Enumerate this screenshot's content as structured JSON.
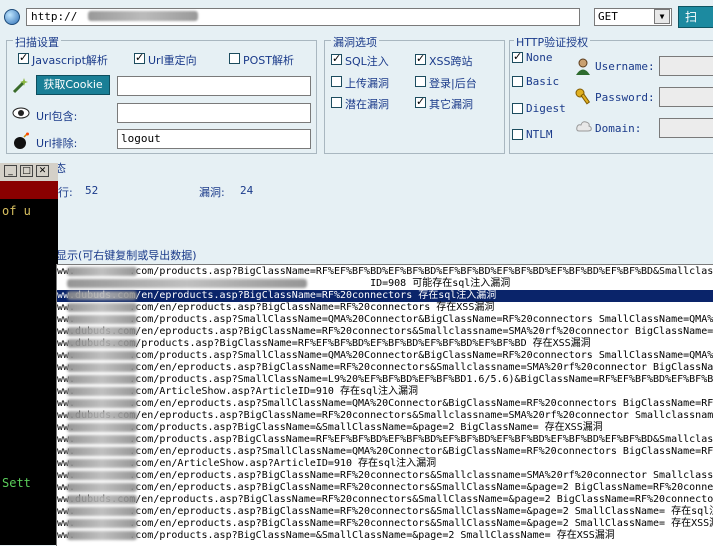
{
  "toolbar": {
    "url_value": "http://",
    "method_value": "GET",
    "scan_label": "扫"
  },
  "scan_settings": {
    "legend": "扫描设置",
    "js_parse": "Javascript解析",
    "url_redirect": "Url重定向",
    "post_parse": "POST解析",
    "get_cookie": "获取Cookie",
    "url_include": "Url包含:",
    "url_exclude": "Url排除:",
    "url_exclude_value": "logout"
  },
  "vuln_options": {
    "legend": "漏洞选项",
    "sql": "SQL注入",
    "xss": "XSS跨站",
    "upload": "上传漏洞",
    "login": "登录|后台",
    "latent": "潜在漏洞",
    "other": "其它漏洞"
  },
  "http_auth": {
    "legend": "HTTP验证授权",
    "none": "None",
    "basic": "Basic",
    "digest": "Digest",
    "ntlm": "NTLM",
    "username": "Username:",
    "password": "Password:",
    "domain": "Domain:"
  },
  "status": {
    "title_partial": "态",
    "rows_label": "行:",
    "rows_value": "52",
    "vulns_label": "漏洞:",
    "vulns_value": "24",
    "results_hint": "显示(可右键复制或导出数据)"
  },
  "mini_window": {
    "text1": "of u",
    "text2": "Sett"
  },
  "results": [
    {
      "text": "ww.         .com/products.asp?BigClassName=RF%EF%BF%BD%EF%BF%BD%EF%BF%BD%EF%BF%BD%EF%BF%BD%EF%BF%BD&Smallclassname"
    },
    {
      "text": "                                                    ID=908 可能存在sql注入漏洞"
    },
    {
      "text": "ww.dubuds.com/en/eproducts.asp?BigClassName=RF%20connectors 存在sql注入漏洞"
    },
    {
      "text": "ww.         .com/en/eproducts.asp?BigClassName=RF%20connectors 存在XSS漏洞"
    },
    {
      "text": "ww.         .com/products.asp?SmallClassName=QMA%20Connector&BigClassName=RF%20connectors SmallClassName=QMA%"
    },
    {
      "text": "ww.dubuds.com/en/eproducts.asp?BigClassName=RF%20connectors&Smallclassname=SMA%20rf%20connector BigClassName=R"
    },
    {
      "text": "ww.dubuds.com/products.asp?BigClassName=RF%EF%BF%BD%EF%BF%BD%EF%BF%BD%EF%BF%BD 存在XSS漏洞"
    },
    {
      "text": "ww.         .com/products.asp?SmallClassName=QMA%20Connector&BigClassName=RF%20connectors SmallClassName=QMA%"
    },
    {
      "text": "ww.         .com/en/eproducts.asp?BigClassName=RF%20connectors&Smallclassname=SMA%20rf%20connector BigClassName=R"
    },
    {
      "text": "ww.         .com/products.asp?SmallClassName=L9%20%EF%BF%BD%EF%BF%BD1.6/5.6)&BigClassName=RF%EF%BF%BD%EF%BF%BD%EF"
    },
    {
      "text": "ww.         .com/ArticleShow.asp?ArticleID=910 存在sql注入漏洞"
    },
    {
      "text": "ww.         .com/en/eproducts.asp?SmallClassName=QMA%20Connector&BigClassName=RF%20connectors BigClassName=RF%20co"
    },
    {
      "text": "ww.dubuds.com/en/eproducts.asp?BigClassName=RF%20connectors&Smallclassname=SMA%20rf%20connector Smallclassname"
    },
    {
      "text": "ww.         .com/products.asp?BigClassName=&SmallClassName=&page=2 BigClassName= 存在XSS漏洞"
    },
    {
      "text": "ww.         .com/products.asp?BigClassName=RF%EF%BF%BD%EF%BF%BD%EF%BF%BD%EF%BF%BD%EF%BF%BD%EF%BF%BD&Smallclassname"
    },
    {
      "text": "ww.         .com/en/eproducts.asp?SmallClassName=QMA%20Connector&BigClassName=RF%20connectors BigClassName=RF%20co"
    },
    {
      "text": "ww.         .com/en/ArticleShow.asp?ArticleID=910 存在sql注入漏洞"
    },
    {
      "text": "ww.         .com/en/eproducts.asp?BigClassName=RF%20connectors&Smallclassname=SMA%20rf%20connector Smallclassname"
    },
    {
      "text": "ww.         .com/en/eproducts.asp?BigClassName=RF%20connectors&SmallClassName=&page=2 BigClassName=RF%20connector"
    },
    {
      "text": "ww.dubuds.com/en/eproducts.asp?BigClassName=RF%20connectors&SmallClassName=&page=2 BigClassName=RF%20connector"
    },
    {
      "text": "ww.         .com/en/eproducts.asp?BigClassName=RF%20connectors&SmallClassName=&page=2 SmallClassName= 存在sql注入"
    },
    {
      "text": "ww.         .com/en/eproducts.asp?BigClassName=RF%20connectors&SmallClassName=&page=2 SmallClassName= 存在XSS漏洞"
    },
    {
      "text": "ww.         .com/products.asp?BigClassName=&SmallClassName=&page=2 SmallClassName= 存在XSS漏洞"
    }
  ],
  "colors": {
    "background": "#e6f0f4",
    "selected_row": "#0a246a",
    "accent": "#1a7f96"
  }
}
